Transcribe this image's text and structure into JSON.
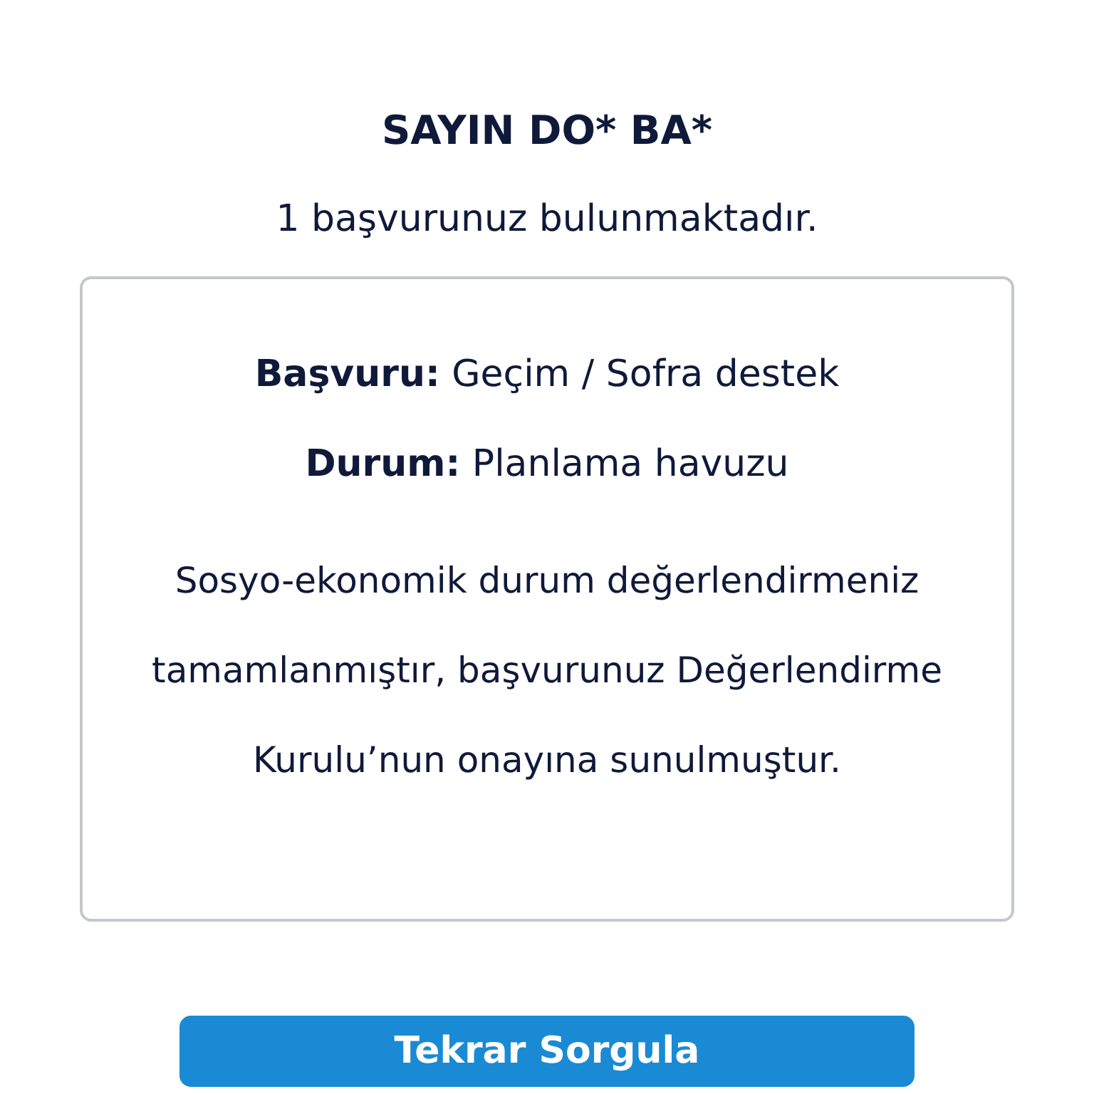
{
  "title": "SAYIN DO* BA*",
  "summary": "1 başvurunuz bulunmaktadır.",
  "details": [
    "**Başvuru:** Geçim / Sofra destek",
    "**Durum:** Planlama havuzu"
  ],
  "message": "Sosyo-ekonomik durum değerlendirmeniz tamamlanmıştır, başvurunuz Değerlendirme Kurulu’nun onayına sunulmuştur.",
  "button": "Tekrar Sorgula"
}
